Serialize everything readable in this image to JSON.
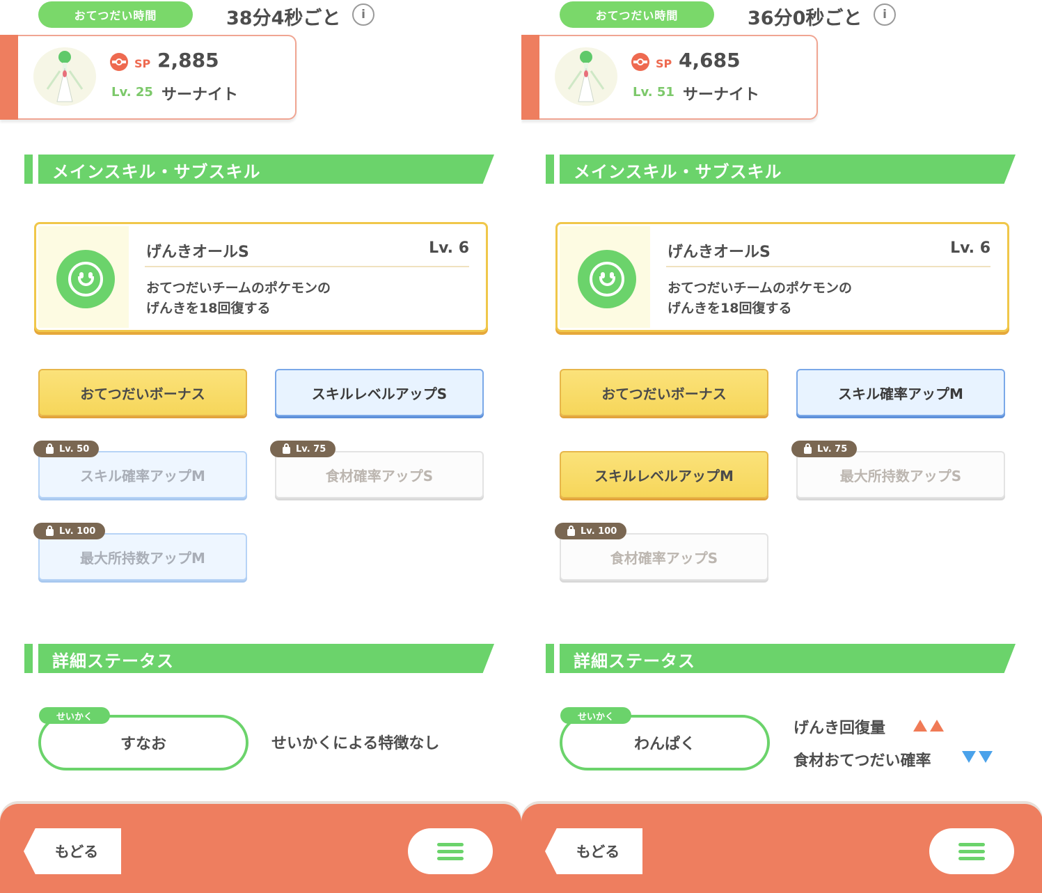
{
  "panels": [
    {
      "help_label": "おてつだい時間",
      "help_value": "38分4秒ごと",
      "info": "i",
      "sp_label": "SP",
      "sp_value": "2,885",
      "level": "Lv. 25",
      "pokemon_name": "サーナイト",
      "section_skills": "メインスキル・サブスキル",
      "main_skill": {
        "name": "げんきオールS",
        "level": "Lv. 6",
        "desc1": "おてつだいチームのポケモンの",
        "desc2": "げんきを18回復する"
      },
      "sub_skills": [
        {
          "label": "おてつだいボーナス"
        },
        {
          "label": "スキルレベルアップS"
        },
        {
          "label": "スキル確率アップM",
          "lock": "Lv. 50"
        },
        {
          "label": "食材確率アップS",
          "lock": "Lv. 75"
        },
        {
          "label": "最大所持数アップM",
          "lock": "Lv. 100"
        }
      ],
      "section_status": "詳細ステータス",
      "nature_tag": "せいかく",
      "nature": "すなお",
      "nature_effect": "せいかくによる特徴なし",
      "back": "もどる"
    },
    {
      "help_label": "おてつだい時間",
      "help_value": "36分0秒ごと",
      "info": "i",
      "sp_label": "SP",
      "sp_value": "4,685",
      "level": "Lv. 51",
      "pokemon_name": "サーナイト",
      "section_skills": "メインスキル・サブスキル",
      "main_skill": {
        "name": "げんきオールS",
        "level": "Lv. 6",
        "desc1": "おてつだいチームのポケモンの",
        "desc2": "げんきを18回復する"
      },
      "sub_skills": [
        {
          "label": "おてつだいボーナス"
        },
        {
          "label": "スキル確率アップM"
        },
        {
          "label": "スキルレベルアップM"
        },
        {
          "label": "最大所持数アップS",
          "lock": "Lv. 75"
        },
        {
          "label": "食材確率アップS",
          "lock": "Lv. 100"
        }
      ],
      "section_status": "詳細ステータス",
      "nature_tag": "せいかく",
      "nature": "わんぱく",
      "nature_effects": [
        {
          "label": "げんき回復量",
          "direction": "up"
        },
        {
          "label": "食材おてつだい確率",
          "direction": "down"
        }
      ],
      "back": "もどる"
    }
  ],
  "colors": {
    "green": "#6bd36b",
    "coral": "#ee7e5f",
    "gold": "#f6d65a",
    "blue": "#7aa8e8"
  }
}
